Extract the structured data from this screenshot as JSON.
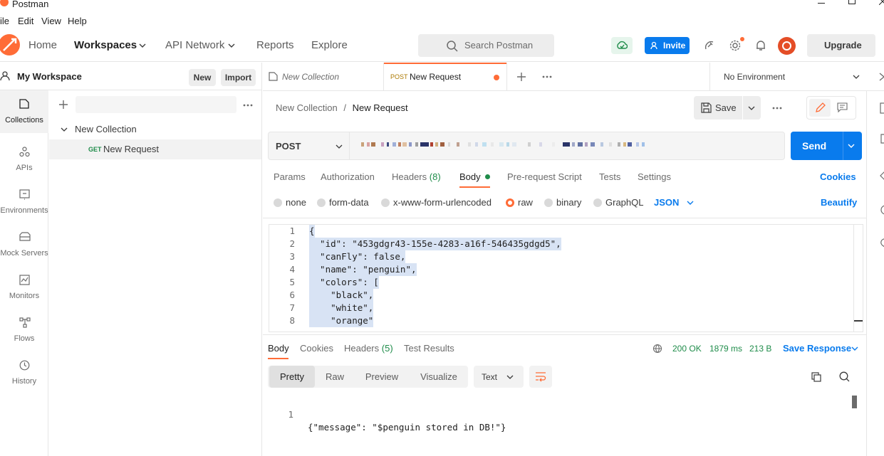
{
  "window": {
    "title": "Postman",
    "controls": [
      "minimize-icon",
      "maximize-icon",
      "close-icon"
    ]
  },
  "menubar": {
    "items": [
      "ile",
      "Edit",
      "View",
      "Help"
    ]
  },
  "header": {
    "nav": [
      "Home",
      "Workspaces",
      "API Network",
      "Reports",
      "Explore"
    ],
    "search_placeholder": "Search Postman",
    "invite_label": "Invite",
    "upgrade_label": "Upgrade",
    "colors": {
      "brand": "#ff6c37",
      "accent": "#097bed",
      "status_dot": "#ff6c37"
    }
  },
  "workspace": {
    "name": "My Workspace",
    "new_label": "New",
    "import_label": "Import"
  },
  "rail": {
    "items": [
      {
        "label": "Collections",
        "icon": "collections-icon",
        "active": true
      },
      {
        "label": "APIs",
        "icon": "apis-icon",
        "active": false
      },
      {
        "label": "Environments",
        "icon": "environments-icon",
        "active": false
      },
      {
        "label": "Mock Servers",
        "icon": "mock-servers-icon",
        "active": false
      },
      {
        "label": "Monitors",
        "icon": "monitors-icon",
        "active": false
      },
      {
        "label": "Flows",
        "icon": "flows-icon",
        "active": false
      },
      {
        "label": "History",
        "icon": "history-icon",
        "active": false
      }
    ]
  },
  "sidebar": {
    "collection_name": "New Collection",
    "request_method": "GET",
    "request_name": "New Request"
  },
  "tabs": {
    "items": [
      {
        "label": "New Collection",
        "method": ""
      },
      {
        "label": "New Request",
        "method": "POST",
        "unsaved": true
      }
    ],
    "environment": "No Environment"
  },
  "breadcrumb": {
    "parent": "New Collection",
    "separator": "/",
    "current": "New Request"
  },
  "toolbar": {
    "save_label": "Save"
  },
  "request": {
    "method": "POST",
    "send_label": "Send",
    "tabs": [
      "Params",
      "Authorization",
      "Headers",
      "Body",
      "Pre-request Script",
      "Tests",
      "Settings"
    ],
    "headers_count": "(8)",
    "active_tab": "Body",
    "cookies_label": "Cookies",
    "body_modes": [
      "none",
      "form-data",
      "x-www-form-urlencoded",
      "raw",
      "binary",
      "GraphQL"
    ],
    "active_mode": "raw",
    "format": "JSON",
    "beautify_label": "Beautify"
  },
  "editor": {
    "lines": [
      {
        "n": "1",
        "text": "{"
      },
      {
        "n": "2",
        "text": "  \"id\": \"453gdgr43-155e-4283-a16f-546435gdgd5\","
      },
      {
        "n": "3",
        "text": "  \"canFly\": false,"
      },
      {
        "n": "4",
        "text": "  \"name\": \"penguin\","
      },
      {
        "n": "5",
        "text": "  \"colors\": ["
      },
      {
        "n": "6",
        "text": "    \"black\","
      },
      {
        "n": "7",
        "text": "    \"white\","
      },
      {
        "n": "8",
        "text": "    \"orange\""
      }
    ]
  },
  "response": {
    "tabs": [
      "Body",
      "Cookies",
      "Headers",
      "Test Results"
    ],
    "headers_count": "(5)",
    "status": "200 OK",
    "time": "1879 ms",
    "size": "213 B",
    "save_response_label": "Save Response",
    "view_tabs": [
      "Pretty",
      "Raw",
      "Preview",
      "Visualize"
    ],
    "active_view": "Pretty",
    "type_select": "Text",
    "lines": [
      {
        "n": "1",
        "text": "{\"message\": \"$penguin stored in DB!\"}"
      }
    ]
  }
}
